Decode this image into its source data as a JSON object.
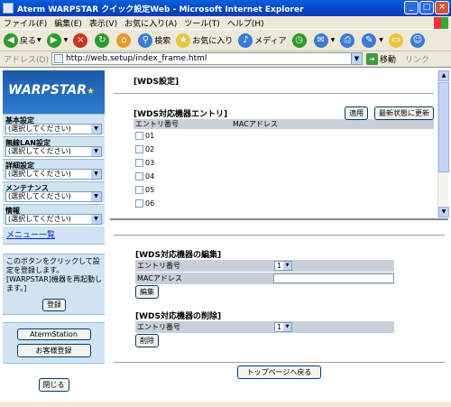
{
  "window": {
    "title": "Aterm WARPSTAR クイック設定Web - Microsoft Internet Explorer",
    "minimize": "_",
    "maximize": "□",
    "close": "×"
  },
  "menu": [
    "ファイル(F)",
    "編集(E)",
    "表示(V)",
    "お気に入り(A)",
    "ツール(T)",
    "ヘルプ(H)"
  ],
  "toolbar": {
    "back": "戻る",
    "search": "検索",
    "favorites": "お気に入り",
    "media": "メディア"
  },
  "address": {
    "label": "アドレス(D)",
    "url": "http://web.setup/index_frame.html",
    "go": "移動",
    "links": "リンク"
  },
  "sidebar": {
    "logo": "WARPSTAR",
    "groups": [
      {
        "label": "基本設定",
        "select": "(選択してください)"
      },
      {
        "label": "無線LAN設定",
        "select": "(選択してください)"
      },
      {
        "label": "詳細設定",
        "select": "(選択してください)"
      },
      {
        "label": "メンテナンス",
        "select": "(選択してください)"
      },
      {
        "label": "情報",
        "select": "(選択してください)"
      }
    ],
    "menu_list": "メニュー一覧",
    "info_text": "このボタンをクリックして設定を登録します。[WARPSTAR]機器を再起動します。]",
    "register_button": "登録",
    "aterm_station_button": "AtermStation",
    "support_button": "お客様登録",
    "close_button": "閉じる"
  },
  "wds": {
    "title": "[WDS設定]",
    "entries_title": "[WDS対応機器エントリ]",
    "apply_button": "適用",
    "refresh_button": "最新状態に更新",
    "col_entry": "エントリ番号",
    "col_mac": "MACアドレス",
    "entries": [
      "01",
      "02",
      "03",
      "04",
      "05",
      "06"
    ],
    "edit_title": "[WDS対応機器の編集]",
    "edit_entry_label": "エントリ番号",
    "edit_entry_value": "1",
    "edit_mac_label": "MACアドレス",
    "edit_button": "編集",
    "delete_title": "[WDS対応機器の削除]",
    "delete_entry_label": "エントリ番号",
    "delete_entry_value": "1",
    "delete_button": "削除",
    "top_button": "トップページへ戻る"
  }
}
